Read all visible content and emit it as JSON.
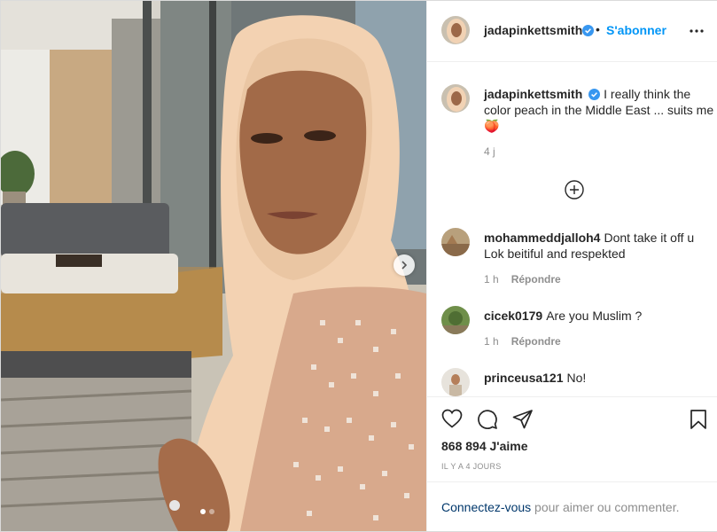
{
  "post": {
    "username": "jadapinkettsmith",
    "follow_label": "S'abonner",
    "separator": "•",
    "carousel_dots": 2
  },
  "caption": {
    "username": "jadapinkettsmith",
    "text": "I really think the color peach in the Middle East ... suits me🍑",
    "time": "4 j"
  },
  "comments": [
    {
      "username": "mohammeddjalloh4",
      "text": "Dont take it off u Lok beitiful and respekted",
      "time": "1 h",
      "reply_label": "Répondre"
    },
    {
      "username": "cicek0179",
      "text": "Are you Muslim ?",
      "time": "1 h",
      "reply_label": "Répondre"
    },
    {
      "username": "princeusa121",
      "text": "No!"
    }
  ],
  "stats": {
    "likes": "868 894 J'aime",
    "posted_ago": "IL Y A 4 JOURS"
  },
  "footer": {
    "login_link": "Connectez-vous",
    "login_rest": " pour aimer ou commenter."
  },
  "icons": {
    "verified": "verified-badge-icon",
    "more": "more-options-icon",
    "heart": "heart-icon",
    "comment": "comment-icon",
    "share": "share-icon",
    "save": "bookmark-icon",
    "load_more": "plus-circle-icon",
    "next": "chevron-right-icon"
  },
  "colors": {
    "accent": "#0095f6",
    "link": "#00376b",
    "muted": "#8e8e8e",
    "verified": "#3897f0"
  }
}
